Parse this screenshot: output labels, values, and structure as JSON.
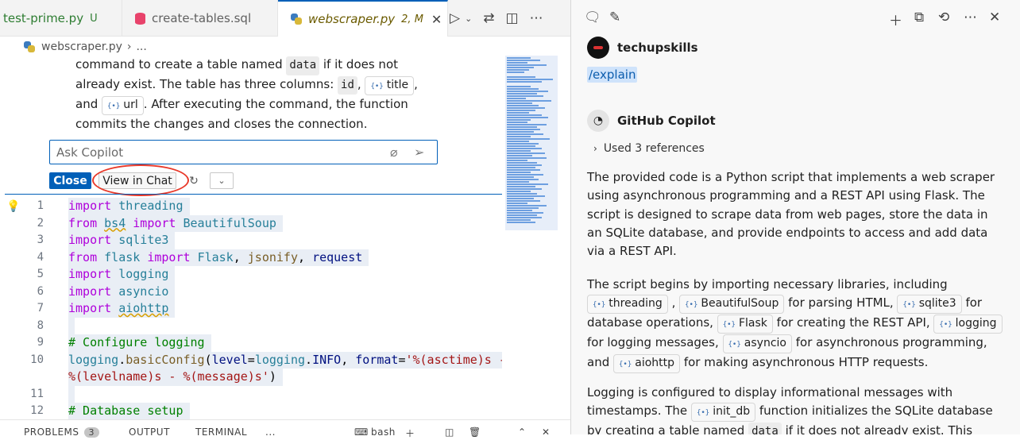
{
  "tabs": [
    {
      "name": "test-prime.py",
      "status": "U"
    },
    {
      "name": "create-tables.sql",
      "status": ""
    },
    {
      "name": "webscraper.py",
      "status": "2, M"
    }
  ],
  "breadcrumb": {
    "file": "webscraper.py",
    "more": "..."
  },
  "inline_chat": {
    "explain_parts": [
      "command to create a table named ",
      "data",
      " if it does not already exist. The table has three columns: ",
      "id",
      ", ",
      "title",
      ", and ",
      "url",
      ". After executing the command, the function commits the changes and closes the connection."
    ],
    "placeholder": "Ask Copilot",
    "close_label": "Close",
    "view_label": "View in Chat"
  },
  "code": {
    "lines": [
      {
        "n": "1",
        "html_parts": [
          [
            "kw",
            "import"
          ],
          [
            "op",
            " "
          ],
          [
            "mod-n",
            "threading"
          ]
        ]
      },
      {
        "n": "2",
        "html_parts": [
          [
            "kw",
            "from"
          ],
          [
            "op",
            " "
          ],
          [
            "mod-n squiggle",
            "bs4"
          ],
          [
            "op",
            " "
          ],
          [
            "kw",
            "import"
          ],
          [
            "op",
            " "
          ],
          [
            "mod-n",
            "BeautifulSoup"
          ]
        ]
      },
      {
        "n": "3",
        "html_parts": [
          [
            "kw",
            "import"
          ],
          [
            "op",
            " "
          ],
          [
            "mod-n",
            "sqlite3"
          ]
        ]
      },
      {
        "n": "4",
        "html_parts": [
          [
            "kw",
            "from"
          ],
          [
            "op",
            " "
          ],
          [
            "mod-n",
            "flask"
          ],
          [
            "op",
            " "
          ],
          [
            "kw",
            "import"
          ],
          [
            "op",
            " "
          ],
          [
            "mod-n",
            "Flask"
          ],
          [
            "op",
            ", "
          ],
          [
            "fn",
            "jsonify"
          ],
          [
            "op",
            ", "
          ],
          [
            "var",
            "request"
          ]
        ]
      },
      {
        "n": "5",
        "html_parts": [
          [
            "kw",
            "import"
          ],
          [
            "op",
            " "
          ],
          [
            "mod-n",
            "logging"
          ]
        ]
      },
      {
        "n": "6",
        "html_parts": [
          [
            "kw",
            "import"
          ],
          [
            "op",
            " "
          ],
          [
            "mod-n",
            "asyncio"
          ]
        ]
      },
      {
        "n": "7",
        "html_parts": [
          [
            "kw",
            "import"
          ],
          [
            "op",
            " "
          ],
          [
            "mod-n squiggle",
            "aiohttp"
          ]
        ]
      },
      {
        "n": "8",
        "html_parts": []
      },
      {
        "n": "9",
        "html_parts": [
          [
            "cmt",
            "# Configure logging"
          ]
        ]
      },
      {
        "n": "10",
        "html_parts": [
          [
            "mod-n",
            "logging"
          ],
          [
            "op",
            "."
          ],
          [
            "fn",
            "basicConfig"
          ],
          [
            "op",
            "("
          ],
          [
            "var",
            "level"
          ],
          [
            "op",
            "="
          ],
          [
            "mod-n",
            "logging"
          ],
          [
            "op",
            "."
          ],
          [
            "var",
            "INFO"
          ],
          [
            "op",
            ", "
          ],
          [
            "var",
            "format"
          ],
          [
            "op",
            "="
          ],
          [
            "str",
            "'%(asctime)s -"
          ]
        ]
      },
      {
        "n": "",
        "html_parts": [
          [
            "str",
            "%(levelname)s - %(message)s'"
          ],
          [
            "op",
            ")"
          ]
        ]
      },
      {
        "n": "11",
        "html_parts": []
      },
      {
        "n": "12",
        "html_parts": [
          [
            "cmt",
            "# Database setup"
          ]
        ]
      }
    ]
  },
  "panel": {
    "problems": "PROBLEMS",
    "problems_count": "3",
    "output": "OUTPUT",
    "terminal": "TERMINAL",
    "more": "...",
    "shell": "bash"
  },
  "chat": {
    "user": "techupskills",
    "command": "/explain",
    "bot": "GitHub Copilot",
    "refs": "Used 3 references",
    "para1": "The provided code is a Python script that implements a web scraper using asynchronous programming and a REST API using Flask. The script is designed to scrape data from web pages, store the data in an SQLite database, and provide endpoints to access and add data via a REST API.",
    "para2_parts": [
      "The script begins by importing necessary libraries, including ",
      "threading",
      " , ",
      "BeautifulSoup",
      " for parsing HTML, ",
      "sqlite3",
      " for database operations, ",
      "Flask",
      " for creating the REST API, ",
      "logging",
      " for logging messages, ",
      "asyncio",
      " for asynchronous programming, and ",
      "aiohttp",
      " for making asynchronous HTTP requests."
    ],
    "para3_parts": [
      "Logging is configured to display informational messages with timestamps. The ",
      "init_db",
      " function initializes the SQLite database by creating a table named ",
      "data",
      " if it does not already exist. This table has"
    ]
  },
  "colors": {
    "accent": "#005fb8",
    "highlight_ring": "#e8392a"
  }
}
